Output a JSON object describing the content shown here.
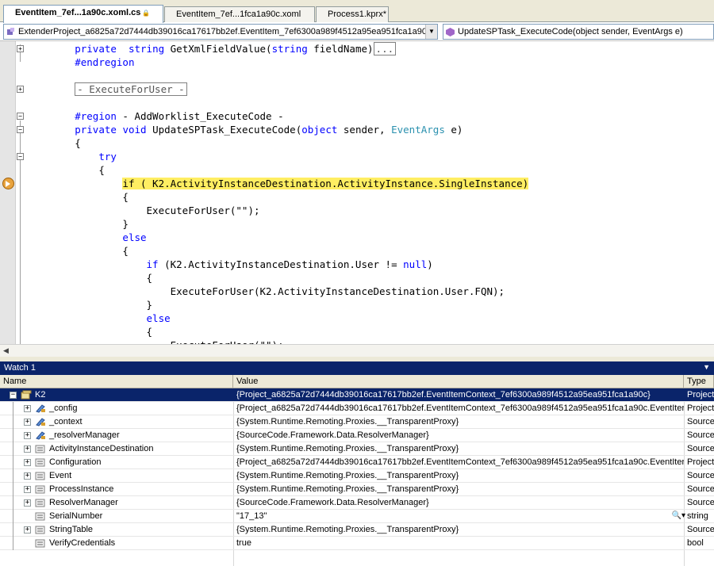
{
  "tabs": [
    {
      "label": "EventItem_7ef...1a90c.xoml.cs",
      "active": true
    },
    {
      "label": "EventItem_7ef...1fca1a90c.xoml",
      "active": false
    },
    {
      "label": "Process1.kprx*",
      "active": false
    }
  ],
  "nav": {
    "left_combo": "ExtenderProject_a6825a72d7444db39016ca17617bb2ef.EventItem_7ef6300a989f4512a95ea951fca1a90",
    "right_combo": "UpdateSPTask_ExecuteCode(object sender, EventArgs e)"
  },
  "code_lines": [
    {
      "pre": "        ",
      "parts": [
        [
          "kw",
          "private"
        ],
        [
          "",
          "  "
        ],
        [
          "kw",
          "string"
        ],
        [
          "",
          " GetXmlFieldValue("
        ],
        [
          "kw",
          "string"
        ],
        [
          "",
          " fieldName)"
        ]
      ],
      "collapsed": "..."
    },
    {
      "pre": "        ",
      "parts": [
        [
          "kw",
          "#endregion"
        ]
      ]
    },
    {
      "pre": "",
      "parts": []
    },
    {
      "pre": "        ",
      "parts": [],
      "collapsed": "- ExecuteForUser -"
    },
    {
      "pre": "",
      "parts": []
    },
    {
      "pre": "        ",
      "parts": [
        [
          "kw",
          "#region"
        ],
        [
          "",
          " - AddWorklist_ExecuteCode -"
        ]
      ]
    },
    {
      "pre": "        ",
      "parts": [
        [
          "kw",
          "private"
        ],
        [
          "",
          " "
        ],
        [
          "kw",
          "void"
        ],
        [
          "",
          " UpdateSPTask_ExecuteCode("
        ],
        [
          "kw",
          "object"
        ],
        [
          "",
          " sender, "
        ],
        [
          "ty",
          "EventArgs"
        ],
        [
          "",
          " e)"
        ]
      ]
    },
    {
      "pre": "        ",
      "parts": [
        [
          "",
          "{"
        ]
      ]
    },
    {
      "pre": "            ",
      "parts": [
        [
          "kw",
          "try"
        ]
      ]
    },
    {
      "pre": "            ",
      "parts": [
        [
          "",
          "{"
        ]
      ]
    },
    {
      "pre": "                ",
      "parts": [
        [
          "hl",
          "if ( K2.ActivityInstanceDestination.ActivityInstance.SingleInstance)"
        ]
      ]
    },
    {
      "pre": "                ",
      "parts": [
        [
          "",
          "{"
        ]
      ]
    },
    {
      "pre": "                    ",
      "parts": [
        [
          "",
          "ExecuteForUser(\"\");"
        ]
      ]
    },
    {
      "pre": "                ",
      "parts": [
        [
          "",
          "}"
        ]
      ]
    },
    {
      "pre": "                ",
      "parts": [
        [
          "kw",
          "else"
        ]
      ]
    },
    {
      "pre": "                ",
      "parts": [
        [
          "",
          "{"
        ]
      ]
    },
    {
      "pre": "                    ",
      "parts": [
        [
          "kw",
          "if"
        ],
        [
          "",
          " (K2.ActivityInstanceDestination.User != "
        ],
        [
          "kw",
          "null"
        ],
        [
          "",
          ")"
        ]
      ]
    },
    {
      "pre": "                    ",
      "parts": [
        [
          "",
          "{"
        ]
      ]
    },
    {
      "pre": "                        ",
      "parts": [
        [
          "",
          "ExecuteForUser(K2.ActivityInstanceDestination.User.FQN);"
        ]
      ]
    },
    {
      "pre": "                    ",
      "parts": [
        [
          "",
          "}"
        ]
      ]
    },
    {
      "pre": "                    ",
      "parts": [
        [
          "kw",
          "else"
        ]
      ]
    },
    {
      "pre": "                    ",
      "parts": [
        [
          "",
          "{"
        ]
      ]
    },
    {
      "pre": "                        ",
      "parts": [
        [
          "",
          "ExecuteForUser(\"\");"
        ]
      ]
    }
  ],
  "watch": {
    "title": "Watch 1",
    "headers": {
      "name": "Name",
      "value": "Value",
      "type": "Type"
    },
    "rows": [
      {
        "name": "K2",
        "value": "{Project_a6825a72d7444db39016ca17617bb2ef.EventItemContext_7ef6300a989f4512a95ea951fca1a90c}",
        "type": "Project",
        "expand": "−",
        "level": 0,
        "icon": "object-icon",
        "selected": true
      },
      {
        "name": "_config",
        "value": "{Project_a6825a72d7444db39016ca17617bb2ef.EventItemContext_7ef6300a989f4512a95ea951fca1a90c.EventIter",
        "type": "Project",
        "expand": "+",
        "level": 1,
        "icon": "private-field-icon"
      },
      {
        "name": "_context",
        "value": "{System.Runtime.Remoting.Proxies.__TransparentProxy}",
        "type": "Source",
        "expand": "+",
        "level": 1,
        "icon": "private-field-icon"
      },
      {
        "name": "_resolverManager",
        "value": "{SourceCode.Framework.Data.ResolverManager}",
        "type": "Source",
        "expand": "+",
        "level": 1,
        "icon": "private-field-icon"
      },
      {
        "name": "ActivityInstanceDestination",
        "value": "{System.Runtime.Remoting.Proxies.__TransparentProxy}",
        "type": "Source",
        "expand": "+",
        "level": 1,
        "icon": "property-icon"
      },
      {
        "name": "Configuration",
        "value": "{Project_a6825a72d7444db39016ca17617bb2ef.EventItemContext_7ef6300a989f4512a95ea951fca1a90c.EventIter",
        "type": "Project",
        "expand": "+",
        "level": 1,
        "icon": "property-icon"
      },
      {
        "name": "Event",
        "value": "{System.Runtime.Remoting.Proxies.__TransparentProxy}",
        "type": "Source",
        "expand": "+",
        "level": 1,
        "icon": "property-icon"
      },
      {
        "name": "ProcessInstance",
        "value": "{System.Runtime.Remoting.Proxies.__TransparentProxy}",
        "type": "Source",
        "expand": "+",
        "level": 1,
        "icon": "property-icon"
      },
      {
        "name": "ResolverManager",
        "value": "{SourceCode.Framework.Data.ResolverManager}",
        "type": "Source",
        "expand": "+",
        "level": 1,
        "icon": "property-icon"
      },
      {
        "name": "SerialNumber",
        "value": "\"17_13\"",
        "type": "string",
        "expand": "",
        "level": 1,
        "icon": "property-icon",
        "visualizer": true
      },
      {
        "name": "StringTable",
        "value": "{System.Runtime.Remoting.Proxies.__TransparentProxy}",
        "type": "Source",
        "expand": "+",
        "level": 1,
        "icon": "property-icon"
      },
      {
        "name": "VerifyCredentials",
        "value": "true",
        "type": "bool",
        "expand": "",
        "level": 1,
        "icon": "property-icon"
      }
    ]
  },
  "colors": {
    "keyword": "#0000ff",
    "type": "#2b91af",
    "highlight": "#ffee62",
    "selection": "#0a246a"
  }
}
